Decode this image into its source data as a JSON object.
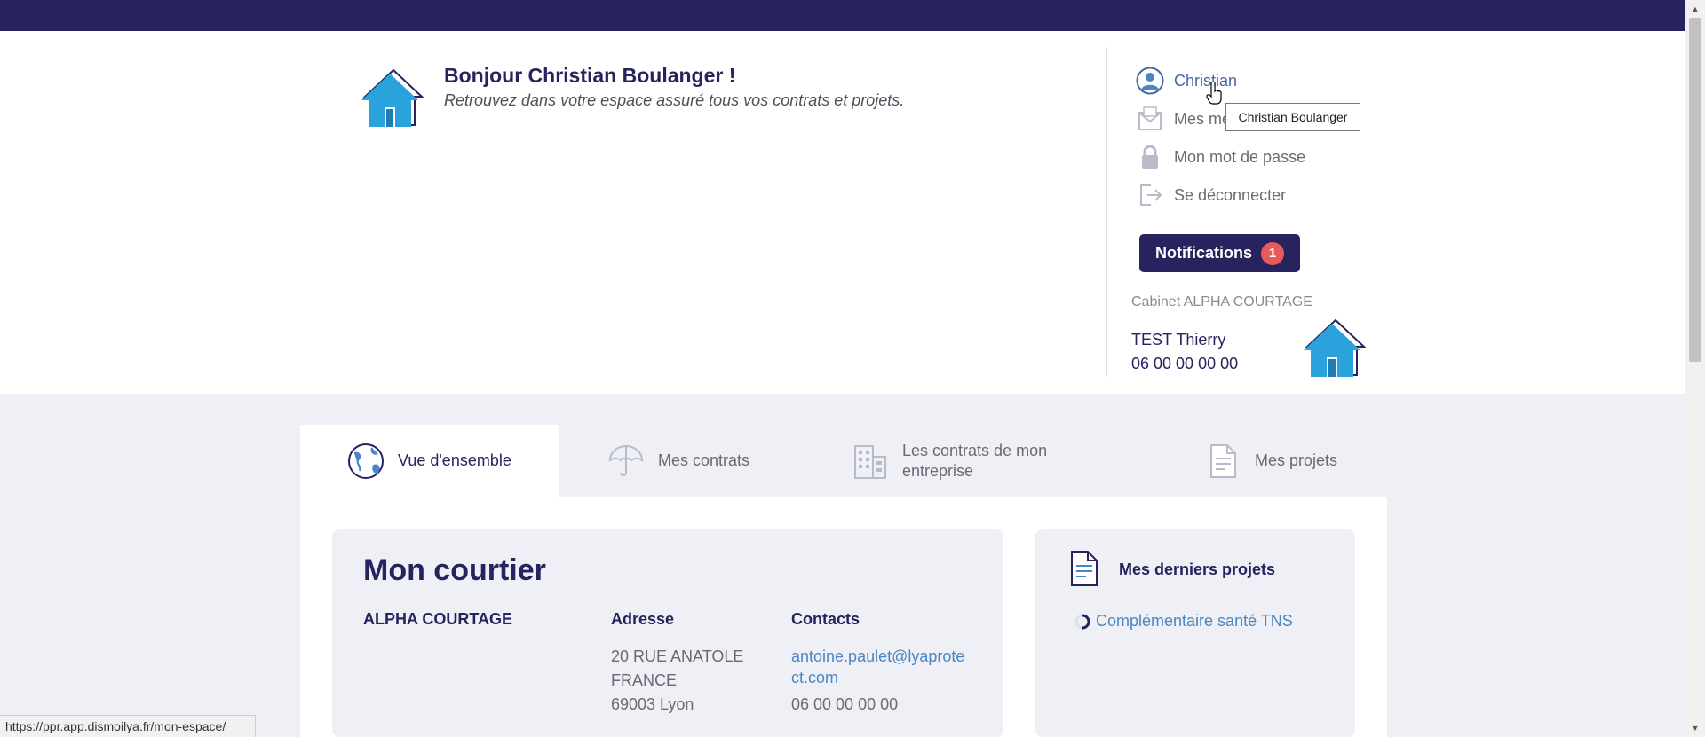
{
  "url_status": "https://ppr.app.dismoilya.fr/mon-espace/",
  "greeting": {
    "title": "Bonjour Christian Boulanger !",
    "subtitle": "Retrouvez dans votre espace assuré tous vos contrats et projets."
  },
  "user_menu": {
    "user_label": "Christian",
    "messages_label": "Mes me",
    "password_label": "Mon mot de passe",
    "logout_label": "Se déconnecter",
    "tooltip": "Christian Boulanger"
  },
  "notifications": {
    "label": "Notifications",
    "count": "1"
  },
  "cabinet": {
    "label": "Cabinet ALPHA COURTAGE",
    "contact_name": "TEST Thierry",
    "contact_phone": "06 00 00 00 00"
  },
  "tabs": [
    {
      "label": "Vue d'ensemble",
      "icon": "globe-icon",
      "active": true
    },
    {
      "label": "Mes contrats",
      "icon": "umbrella-icon",
      "active": false
    },
    {
      "label_line1": "Les contrats de mon",
      "label_line2": "entreprise",
      "icon": "building-icon",
      "active": false
    },
    {
      "label": "Mes projets",
      "icon": "document-icon",
      "active": false
    }
  ],
  "courtier": {
    "title": "Mon courtier",
    "name": "ALPHA COURTAGE",
    "address_header": "Adresse",
    "address_lines": [
      "20 RUE ANATOLE",
      "FRANCE",
      "69003 Lyon"
    ],
    "contacts_header": "Contacts",
    "email_line1": "antoine.paulet@lyaprote",
    "email_line2": "ct.com",
    "phone": "06 00 00 00 00"
  },
  "projets": {
    "title": "Mes derniers projets",
    "items": [
      "Complémentaire santé TNS"
    ]
  },
  "colors": {
    "navy": "#26235f",
    "link": "#4a86c5",
    "badge": "#e85a5a",
    "background": "#eff0f5",
    "house_blue": "#2aa3dc"
  }
}
